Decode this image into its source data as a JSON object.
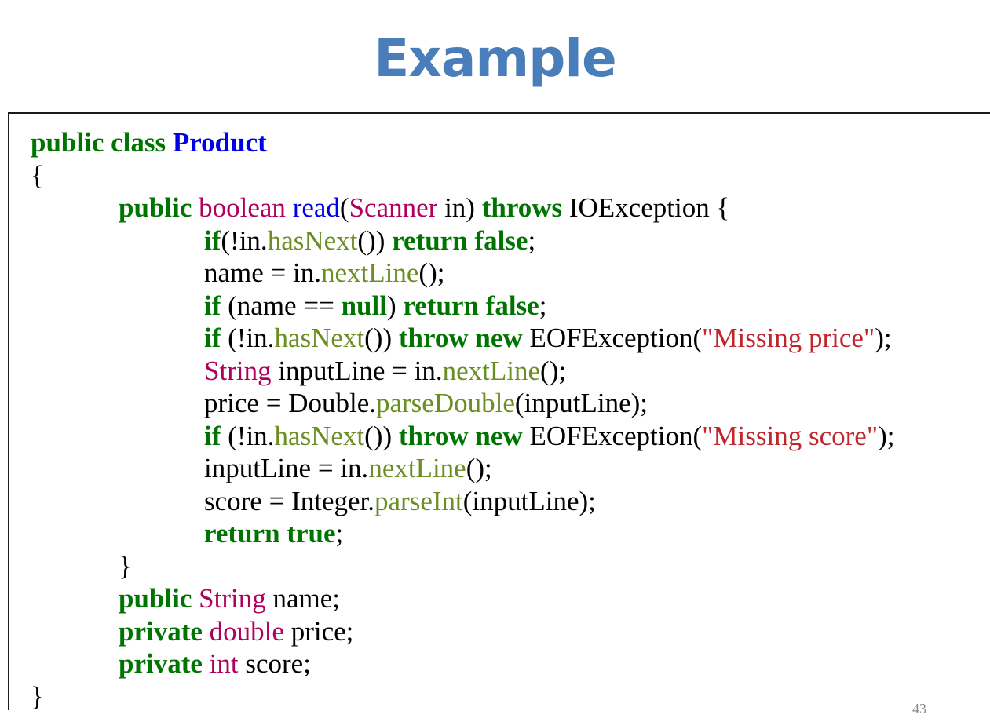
{
  "title": "Example",
  "page_number": "43",
  "code_lines": [
    {
      "indent": 0,
      "tokens": [
        [
          "kw",
          "public class "
        ],
        [
          "cls",
          "Product"
        ]
      ]
    },
    {
      "indent": 0,
      "tokens": [
        [
          "pl",
          "{"
        ]
      ]
    },
    {
      "indent": 1,
      "tokens": [
        [
          "kw",
          "public "
        ],
        [
          "ty",
          "boolean "
        ],
        [
          "fn",
          "read"
        ],
        [
          "pl",
          "("
        ],
        [
          "ty",
          "Scanner"
        ],
        [
          "pl",
          " in) "
        ],
        [
          "kw",
          "throws "
        ],
        [
          "pl",
          "IOException {"
        ]
      ]
    },
    {
      "indent": 2,
      "tokens": [
        [
          "kw",
          "if"
        ],
        [
          "pl",
          "(!in."
        ],
        [
          "mt",
          "hasNext"
        ],
        [
          "pl",
          "()) "
        ],
        [
          "kw",
          "return false"
        ],
        [
          "pl",
          ";"
        ]
      ]
    },
    {
      "indent": 2,
      "tokens": [
        [
          "pl",
          "name = in."
        ],
        [
          "mt",
          "nextLine"
        ],
        [
          "pl",
          "();"
        ]
      ]
    },
    {
      "indent": 2,
      "tokens": [
        [
          "kw",
          "if "
        ],
        [
          "pl",
          "(name == "
        ],
        [
          "kw",
          "null"
        ],
        [
          "pl",
          ") "
        ],
        [
          "kw",
          "return false"
        ],
        [
          "pl",
          ";"
        ]
      ]
    },
    {
      "indent": 2,
      "tokens": [
        [
          "kw",
          "if "
        ],
        [
          "pl",
          "(!in."
        ],
        [
          "mt",
          "hasNext"
        ],
        [
          "pl",
          "()) "
        ],
        [
          "kw",
          "throw new "
        ],
        [
          "pl",
          "EOFException("
        ],
        [
          "str",
          "\"Missing price\""
        ],
        [
          "pl",
          ");"
        ]
      ]
    },
    {
      "indent": 2,
      "tokens": [
        [
          "ty",
          "String "
        ],
        [
          "pl",
          "inputLine = in."
        ],
        [
          "mt",
          "nextLine"
        ],
        [
          "pl",
          "();"
        ]
      ]
    },
    {
      "indent": 2,
      "tokens": [
        [
          "pl",
          "price = Double."
        ],
        [
          "mt",
          "parseDouble"
        ],
        [
          "pl",
          "(inputLine);"
        ]
      ]
    },
    {
      "indent": 2,
      "tokens": [
        [
          "kw",
          "if "
        ],
        [
          "pl",
          "(!in."
        ],
        [
          "mt",
          "hasNext"
        ],
        [
          "pl",
          "()) "
        ],
        [
          "kw",
          "throw new "
        ],
        [
          "pl",
          "EOFException("
        ],
        [
          "str",
          "\"Missing score\""
        ],
        [
          "pl",
          ");"
        ]
      ]
    },
    {
      "indent": 2,
      "tokens": [
        [
          "pl",
          "inputLine = in."
        ],
        [
          "mt",
          "nextLine"
        ],
        [
          "pl",
          "();"
        ]
      ]
    },
    {
      "indent": 2,
      "tokens": [
        [
          "pl",
          "score = Integer."
        ],
        [
          "mt",
          "parseInt"
        ],
        [
          "pl",
          "(inputLine);"
        ]
      ]
    },
    {
      "indent": 2,
      "tokens": [
        [
          "kw",
          "return true"
        ],
        [
          "pl",
          ";"
        ]
      ]
    },
    {
      "indent": 1,
      "tokens": [
        [
          "pl",
          "}"
        ]
      ]
    },
    {
      "indent": 1,
      "tokens": [
        [
          "kw",
          "public "
        ],
        [
          "ty",
          "String "
        ],
        [
          "pl",
          "name;"
        ]
      ]
    },
    {
      "indent": 1,
      "tokens": [
        [
          "kw",
          "private "
        ],
        [
          "ty",
          "double "
        ],
        [
          "pl",
          "price;"
        ]
      ]
    },
    {
      "indent": 1,
      "tokens": [
        [
          "kw",
          "private "
        ],
        [
          "ty",
          "int "
        ],
        [
          "pl",
          "score;"
        ]
      ]
    },
    {
      "indent": 0,
      "tokens": [
        [
          "pl",
          "}"
        ]
      ]
    }
  ]
}
